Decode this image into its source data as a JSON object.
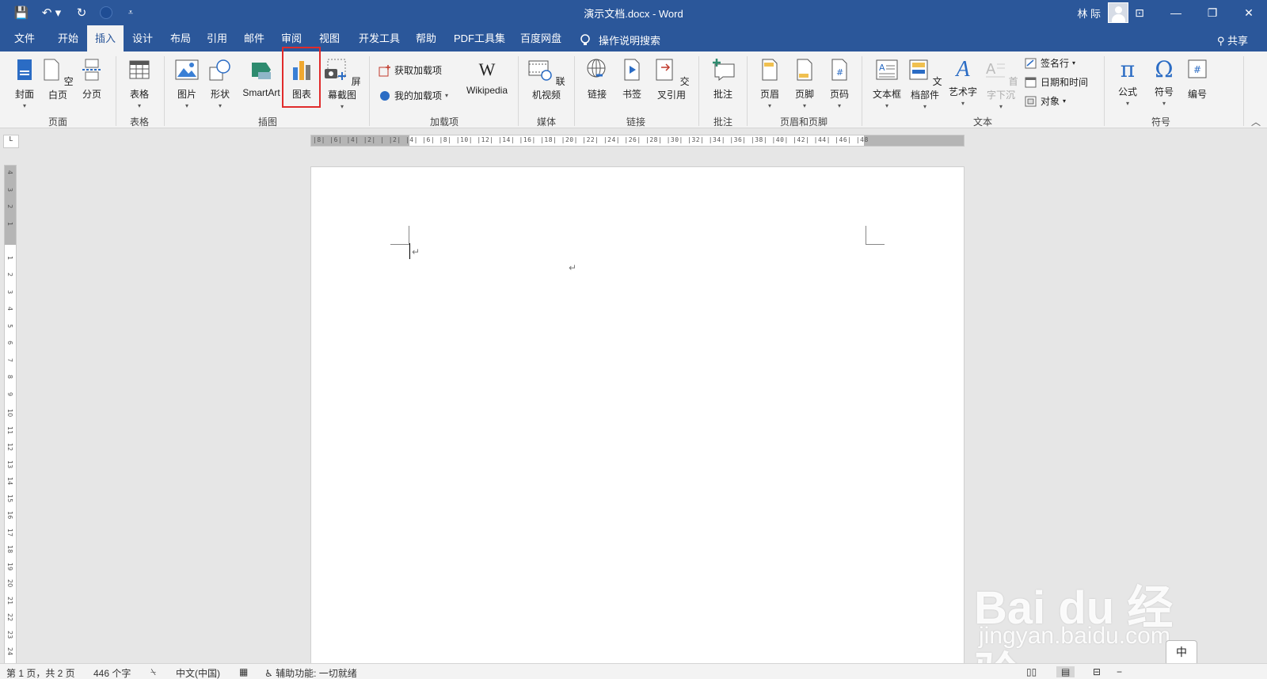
{
  "window": {
    "title": "演示文档.docx  -  Word",
    "user": "林 际",
    "minimize": "—",
    "restore": "❐",
    "close": "✕",
    "ribbon_display": "⊡"
  },
  "qat": {
    "save": "💾",
    "undo": "↶ ▾",
    "redo": "↻",
    "customize": "⩡"
  },
  "tabs": [
    {
      "label": "文件"
    },
    {
      "label": "开始"
    },
    {
      "label": "插入"
    },
    {
      "label": "设计"
    },
    {
      "label": "布局"
    },
    {
      "label": "引用"
    },
    {
      "label": "邮件"
    },
    {
      "label": "审阅"
    },
    {
      "label": "视图"
    },
    {
      "label": "开发工具"
    },
    {
      "label": "帮助"
    },
    {
      "label": "PDF工具集"
    },
    {
      "label": "百度网盘"
    }
  ],
  "tell_me": "操作说明搜索",
  "share": "共享",
  "ribbon": {
    "pages": {
      "cover": "封面",
      "blank": "空白页",
      "break": "分页",
      "label": "页面"
    },
    "tables": {
      "table": "表格",
      "label": "表格"
    },
    "illustrations": {
      "picture": "图片",
      "shapes": "形状",
      "smartart": "SmartArt",
      "chart": "图表",
      "screenshot": "屏幕截图",
      "label": "插图"
    },
    "addins": {
      "get": "获取加载项",
      "my": "我的加载项",
      "wikipedia": "Wikipedia",
      "label": "加载项"
    },
    "media": {
      "video": "联机视频",
      "label": "媒体"
    },
    "links": {
      "link": "链接",
      "bookmark": "书签",
      "crossref": "交叉引用",
      "label": "链接"
    },
    "comments": {
      "comment": "批注",
      "label": "批注"
    },
    "headerfooter": {
      "header": "页眉",
      "footer": "页脚",
      "pagenum": "页码",
      "label": "页眉和页脚"
    },
    "text": {
      "textbox": "文本框",
      "quickparts": "文档部件",
      "wordart": "艺术字",
      "dropcap": "首字下沉",
      "signature": "签名行",
      "datetime": "日期和时间",
      "object": "对象",
      "label": "文本"
    },
    "symbols": {
      "equation": "公式",
      "symbol": "符号",
      "number": "编号",
      "label": "符号"
    }
  },
  "ruler": {
    "h_ticks": "|8|  |6|  |4|  |2|  |  |2|  |4|  |6|  |8|  |10|  |12|  |14|  |16|  |18|  |20|  |22|  |24|  |26|  |28|  |30|  |32|  |34|  |36|  |38|  |40|  |42|  |44|  |46|  |48",
    "v_ticks": [
      "4",
      "3",
      "2",
      "1",
      "",
      "1",
      "2",
      "3",
      "4",
      "5",
      "6",
      "7",
      "8",
      "9",
      "10",
      "11",
      "12",
      "13",
      "14",
      "15",
      "16",
      "17",
      "18",
      "19",
      "20",
      "21",
      "22",
      "23",
      "24"
    ]
  },
  "status": {
    "page": "第 1 页，共 2 页",
    "words": "446 个字",
    "language": "中文(中国)",
    "accessibility": "辅助功能: 一切就绪"
  },
  "watermark": {
    "main": "Bai du 经验",
    "sub": "jingyan.baidu.com"
  },
  "ime": {
    "lang": "中"
  }
}
